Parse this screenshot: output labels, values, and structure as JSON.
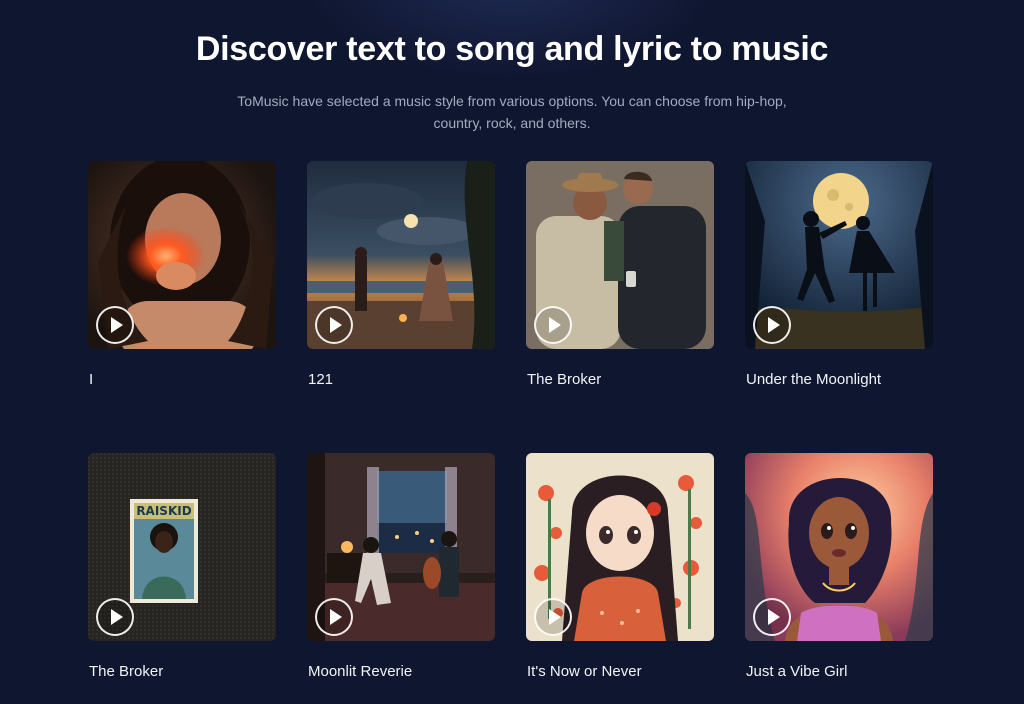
{
  "header": {
    "title": "Discover text to song and lyric to music",
    "subtitle": "ToMusic have selected a music style from various options. You can choose from hip-hop, country, rock, and others."
  },
  "songs": [
    {
      "title": "I",
      "icon": "play-icon"
    },
    {
      "title": "121",
      "icon": "play-icon"
    },
    {
      "title": "The Broker",
      "icon": "play-icon"
    },
    {
      "title": "Under the Moonlight",
      "icon": "play-icon"
    },
    {
      "title": "The Broker",
      "icon": "play-icon",
      "poster_text": "RAISKID"
    },
    {
      "title": "Moonlit Reverie",
      "icon": "play-icon"
    },
    {
      "title": "It's Now or Never",
      "icon": "play-icon"
    },
    {
      "title": "Just a Vibe Girl",
      "icon": "play-icon"
    }
  ],
  "colors": {
    "background": "#0f1630",
    "title": "#ffffff",
    "subtitle": "#a4abc0"
  }
}
